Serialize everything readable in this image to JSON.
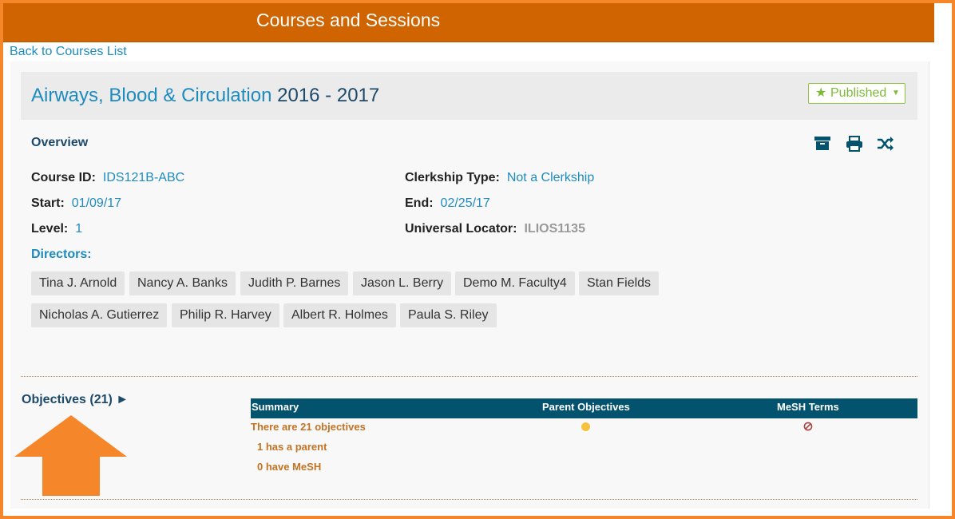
{
  "topbar": {
    "title": "Courses and Sessions"
  },
  "nav": {
    "back_link": "Back to Courses List"
  },
  "course": {
    "name": "Airways, Blood & Circulation",
    "year": "2016 - 2017",
    "status_label": "Published",
    "status_color": "#7dbb36"
  },
  "overview": {
    "heading": "Overview",
    "actions": [
      {
        "icon": "archive-icon",
        "label": "archive"
      },
      {
        "icon": "print-icon",
        "label": "print"
      },
      {
        "icon": "shuffle-icon",
        "label": "rollover"
      }
    ],
    "fields": {
      "course_id": {
        "label": "Course ID:",
        "value": "IDS121B-ABC"
      },
      "start": {
        "label": "Start:",
        "value": "01/09/17"
      },
      "level": {
        "label": "Level:",
        "value": "1"
      },
      "clerkship": {
        "label": "Clerkship Type:",
        "value": "Not a Clerkship"
      },
      "end": {
        "label": "End:",
        "value": "02/25/17"
      },
      "locator": {
        "label": "Universal Locator:",
        "value": "ILIOS1135"
      }
    },
    "directors_label": "Directors:",
    "directors": [
      "Tina J. Arnold",
      "Nancy A. Banks",
      "Judith P. Barnes",
      "Jason L. Berry",
      "Demo M. Faculty4",
      "Stan Fields",
      "Nicholas A. Gutierrez",
      "Philip R. Harvey",
      "Albert R. Holmes",
      "Paula S. Riley"
    ]
  },
  "objectives": {
    "toggle_label": "Objectives (21) ►",
    "columns": [
      "Summary",
      "Parent Objectives",
      "MeSH Terms"
    ],
    "summary_lines": [
      "There are 21 objectives",
      "1 has a parent",
      "0 have MeSH"
    ],
    "parent_status_color": "#f6c23e",
    "mesh_status_color": "#a94442"
  },
  "colors": {
    "accent_orange": "#d06400",
    "frame_orange": "#f6862a",
    "link_blue": "#1e8bbf",
    "table_header": "#03536e"
  }
}
